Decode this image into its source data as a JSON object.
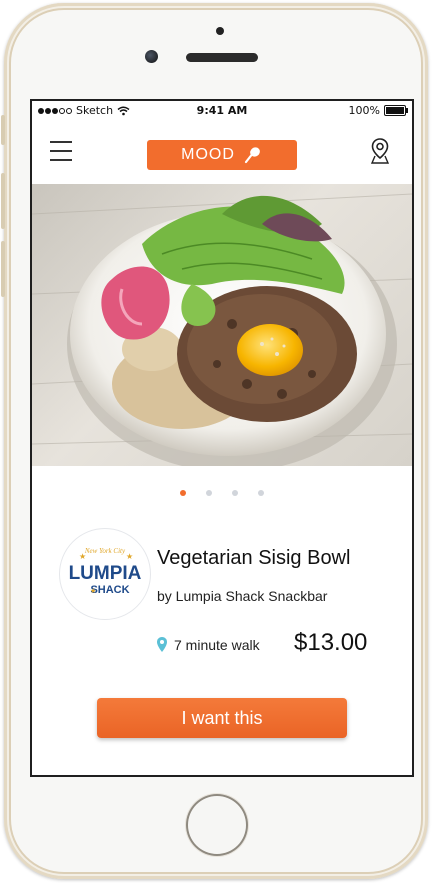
{
  "status_bar": {
    "carrier": "Sketch",
    "time": "9:41 AM",
    "battery": "100%"
  },
  "nav": {
    "menu_icon": "hamburger-menu-icon",
    "mood_label": "MOOD",
    "mood_icon": "spoon-icon",
    "location_icon": "map-pin-icon"
  },
  "carousel": {
    "page_count": 4,
    "active_index": 0
  },
  "dish": {
    "name": "Vegetarian Sisig Bowl",
    "restaurant": "by Lumpia Shack Snackbar",
    "logo_text_top": "New York City",
    "logo_text_main": "LUMPIA",
    "logo_text_sub": "SHACK",
    "walk_time": "7 minute walk",
    "price": "$13.00"
  },
  "cta": {
    "label": "I want this"
  },
  "colors": {
    "accent": "#f26d2d",
    "pin": "#5bc0d6",
    "logo_blue": "#1f4a8a"
  }
}
